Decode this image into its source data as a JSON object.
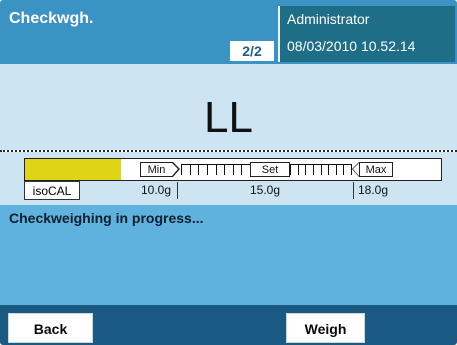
{
  "header": {
    "app_title": "Checkwgh.",
    "page_indicator": "2/2",
    "user": "Administrator",
    "datetime": "08/03/2010 10.52.14",
    "colors": {
      "header_bg": "#3a93c3",
      "user_panel_bg": "#1e6e87"
    }
  },
  "display": {
    "weight_value": "LL"
  },
  "tolerance_bar": {
    "fill_fraction": 0.23,
    "min_label": "Min",
    "set_label": "Set",
    "max_label": "Max",
    "calibration_button": "isoCAL",
    "min_value": "10.0g",
    "set_value": "15.0g",
    "max_value": "18.0g",
    "colors": {
      "fill": "#e0d417"
    }
  },
  "status": {
    "message": "Checkweighing in progress..."
  },
  "footer": {
    "back_label": "Back",
    "weigh_label": "Weigh"
  }
}
